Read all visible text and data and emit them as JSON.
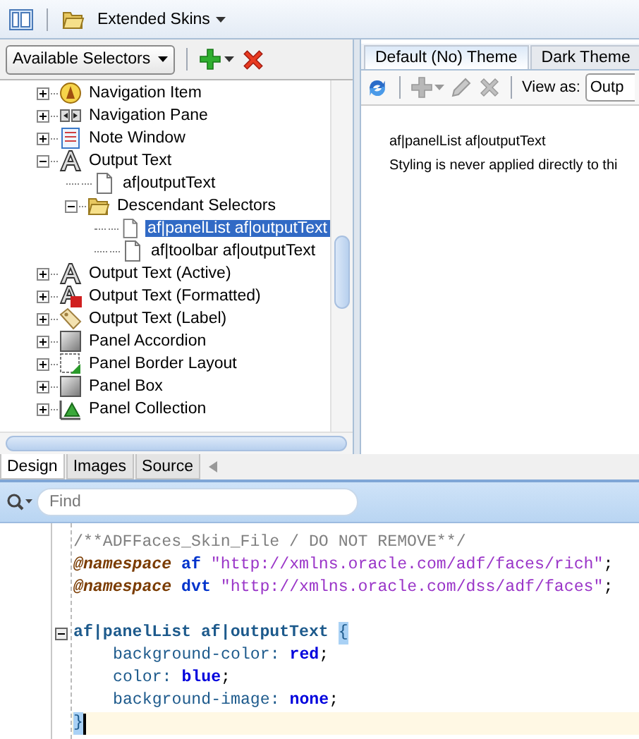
{
  "toolbar": {
    "skin_menu": "Extended Skins"
  },
  "selectors": {
    "dropdown": "Available Selectors",
    "tree": [
      {
        "label": "Navigation Item",
        "kind": "compass",
        "expanded": false,
        "selected": false
      },
      {
        "label": "Navigation Pane",
        "kind": "pane",
        "expanded": false,
        "selected": false
      },
      {
        "label": "Note Window",
        "kind": "note",
        "expanded": false,
        "selected": false
      },
      {
        "label": "Output Text",
        "kind": "text",
        "expanded": true,
        "selected": false,
        "children": [
          {
            "label": "af|outputText",
            "kind": "selector",
            "selected": false
          },
          {
            "label": "Descendant Selectors",
            "kind": "folder",
            "expanded": true,
            "selected": false,
            "children": [
              {
                "label": "af|panelList af|outputText",
                "kind": "selector",
                "selected": true
              },
              {
                "label": "af|toolbar af|outputText",
                "kind": "selector",
                "selected": false
              }
            ]
          }
        ]
      },
      {
        "label": "Output Text (Active)",
        "kind": "text",
        "expanded": false,
        "selected": false
      },
      {
        "label": "Output Text (Formatted)",
        "kind": "text-formatted",
        "expanded": false,
        "selected": false
      },
      {
        "label": "Output Text (Label)",
        "kind": "label",
        "expanded": false,
        "selected": false
      },
      {
        "label": "Panel Accordion",
        "kind": "panel",
        "expanded": false,
        "selected": false
      },
      {
        "label": "Panel Border Layout",
        "kind": "border-layout",
        "expanded": false,
        "selected": false
      },
      {
        "label": "Panel Box",
        "kind": "panel",
        "expanded": false,
        "selected": false
      },
      {
        "label": "Panel Collection",
        "kind": "collection",
        "expanded": false,
        "selected": false
      }
    ]
  },
  "preview": {
    "tabs": [
      {
        "label": "Default (No) Theme",
        "selected": true
      },
      {
        "label": "Dark Theme",
        "selected": false
      }
    ],
    "tools": [
      {
        "kind": "refresh",
        "disabled": false
      },
      {
        "kind": "add",
        "disabled": true
      },
      {
        "kind": "edit",
        "disabled": true
      },
      {
        "kind": "delete",
        "disabled": true
      }
    ],
    "view_as_label": "View as:",
    "view_as_value": "Outp",
    "selector_text": "af|panelList af|outputText",
    "message": "Styling is never applied directly to thi"
  },
  "view_tabs": [
    {
      "label": "Design",
      "selected": true
    },
    {
      "label": "Images",
      "selected": false
    },
    {
      "label": "Source",
      "selected": false
    }
  ],
  "find": {
    "placeholder": "Find"
  },
  "editor": {
    "lines": [
      {
        "kind": "plain",
        "tokens": [
          {
            "kind": "comment",
            "text": "/**ADFFaces_Skin_File / DO NOT REMOVE**/"
          }
        ]
      },
      {
        "kind": "plain",
        "tokens": [
          {
            "kind": "at-rule",
            "text": "@namespace "
          },
          {
            "kind": "prefix",
            "text": "af "
          },
          {
            "kind": "string",
            "text": "\"http://xmlns.oracle.com/adf/faces/rich\""
          },
          {
            "kind": "punct",
            "text": ";"
          }
        ]
      },
      {
        "kind": "plain",
        "tokens": [
          {
            "kind": "at-rule",
            "text": "@namespace "
          },
          {
            "kind": "prefix",
            "text": "dvt "
          },
          {
            "kind": "string",
            "text": "\"http://xmlns.oracle.com/dss/adf/faces\""
          },
          {
            "kind": "punct",
            "text": ";"
          }
        ]
      },
      {
        "kind": "plain"
      },
      {
        "kind": "plain",
        "fold_expanded": true,
        "tokens": [
          {
            "kind": "selector",
            "text": "af|panelList af|outputText "
          },
          {
            "kind": "brace-match",
            "text": "{"
          }
        ]
      },
      {
        "kind": "declaration",
        "tokens": [
          {
            "kind": "property",
            "text": "background-color: "
          },
          {
            "kind": "value",
            "text": "red"
          },
          {
            "kind": "punct",
            "text": ";"
          }
        ]
      },
      {
        "kind": "declaration",
        "tokens": [
          {
            "kind": "property",
            "text": "color: "
          },
          {
            "kind": "value",
            "text": "blue"
          },
          {
            "kind": "punct",
            "text": ";"
          }
        ]
      },
      {
        "kind": "declaration",
        "tokens": [
          {
            "kind": "property",
            "text": "background-image: "
          },
          {
            "kind": "value",
            "text": "none"
          },
          {
            "kind": "punct",
            "text": ";"
          }
        ]
      },
      {
        "kind": "plain",
        "current": true,
        "cursor": true,
        "tokens": [
          {
            "kind": "brace-match",
            "text": "}"
          }
        ]
      }
    ]
  }
}
